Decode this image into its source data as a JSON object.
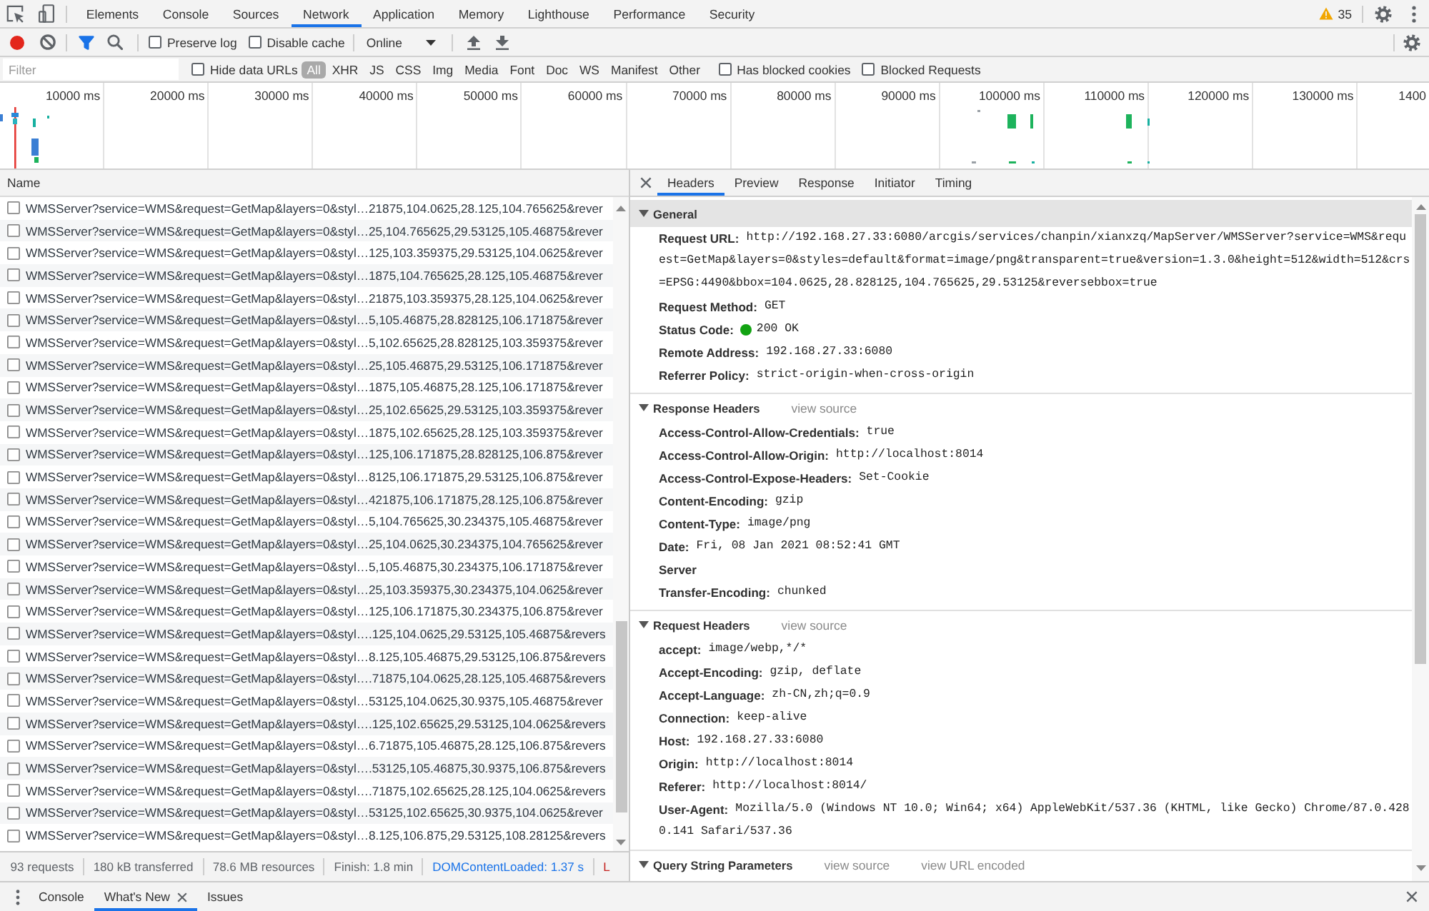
{
  "devtools_tabs": [
    {
      "label": "Elements",
      "selected": false
    },
    {
      "label": "Console",
      "selected": false
    },
    {
      "label": "Sources",
      "selected": false
    },
    {
      "label": "Network",
      "selected": true
    },
    {
      "label": "Application",
      "selected": false
    },
    {
      "label": "Memory",
      "selected": false
    },
    {
      "label": "Lighthouse",
      "selected": false
    },
    {
      "label": "Performance",
      "selected": false
    },
    {
      "label": "Security",
      "selected": false
    }
  ],
  "warnings": {
    "count": "35"
  },
  "toolbar": {
    "recording": true,
    "filter_active": true,
    "checkboxes": [
      {
        "label": "Preserve log",
        "checked": false
      },
      {
        "label": "Disable cache",
        "checked": false
      }
    ],
    "throttling": "Online"
  },
  "filter_bar": {
    "placeholder": "Filter",
    "hide_data_urls": {
      "label": "Hide data URLs",
      "checked": false
    },
    "types": [
      {
        "label": "All",
        "selected": true
      },
      {
        "label": "XHR",
        "selected": false
      },
      {
        "label": "JS",
        "selected": false
      },
      {
        "label": "CSS",
        "selected": false
      },
      {
        "label": "Img",
        "selected": false
      },
      {
        "label": "Media",
        "selected": false
      },
      {
        "label": "Font",
        "selected": false
      },
      {
        "label": "Doc",
        "selected": false
      },
      {
        "label": "WS",
        "selected": false
      },
      {
        "label": "Manifest",
        "selected": false
      },
      {
        "label": "Other",
        "selected": false
      }
    ],
    "checkboxes": [
      {
        "label": "Has blocked cookies",
        "checked": false
      },
      {
        "label": "Blocked Requests",
        "checked": false
      }
    ]
  },
  "overview": {
    "ticks": [
      "10000 ms",
      "20000 ms",
      "30000 ms",
      "40000 ms",
      "50000 ms",
      "60000 ms",
      "70000 ms",
      "80000 ms",
      "90000 ms",
      "100000 ms",
      "110000 ms",
      "120000 ms",
      "130000 ms",
      "1400"
    ]
  },
  "requests": {
    "column": "Name",
    "rows": [
      {
        "name": "WMSServer?service=WMS&request=GetMap&layers=0&styl…21875,104.0625,28.125,104.765625&rever",
        "selected": false
      },
      {
        "name": "WMSServer?service=WMS&request=GetMap&layers=0&styl…25,104.765625,29.53125,105.46875&rever",
        "selected": false
      },
      {
        "name": "WMSServer?service=WMS&request=GetMap&layers=0&styl…125,103.359375,29.53125,104.0625&rever",
        "selected": false
      },
      {
        "name": "WMSServer?service=WMS&request=GetMap&layers=0&styl…1875,104.765625,28.125,105.46875&rever",
        "selected": false
      },
      {
        "name": "WMSServer?service=WMS&request=GetMap&layers=0&styl…21875,103.359375,28.125,104.0625&rever",
        "selected": false
      },
      {
        "name": "WMSServer?service=WMS&request=GetMap&layers=0&styl…5,105.46875,28.828125,106.171875&rever",
        "selected": false
      },
      {
        "name": "WMSServer?service=WMS&request=GetMap&layers=0&styl…5,102.65625,28.828125,103.359375&rever",
        "selected": false
      },
      {
        "name": "WMSServer?service=WMS&request=GetMap&layers=0&styl…25,105.46875,29.53125,106.171875&rever",
        "selected": false
      },
      {
        "name": "WMSServer?service=WMS&request=GetMap&layers=0&styl…1875,105.46875,28.125,106.171875&rever",
        "selected": false
      },
      {
        "name": "WMSServer?service=WMS&request=GetMap&layers=0&styl…25,102.65625,29.53125,103.359375&rever",
        "selected": false
      },
      {
        "name": "WMSServer?service=WMS&request=GetMap&layers=0&styl…1875,102.65625,28.125,103.359375&rever",
        "selected": false
      },
      {
        "name": "WMSServer?service=WMS&request=GetMap&layers=0&styl…125,106.171875,28.828125,106.875&rever",
        "selected": false
      },
      {
        "name": "WMSServer?service=WMS&request=GetMap&layers=0&styl…8125,106.171875,29.53125,106.875&rever",
        "selected": false
      },
      {
        "name": "WMSServer?service=WMS&request=GetMap&layers=0&styl…421875,106.171875,28.125,106.875&rever",
        "selected": false
      },
      {
        "name": "WMSServer?service=WMS&request=GetMap&layers=0&styl…5,104.765625,30.234375,105.46875&rever",
        "selected": false
      },
      {
        "name": "WMSServer?service=WMS&request=GetMap&layers=0&styl…25,104.0625,30.234375,104.765625&rever",
        "selected": false
      },
      {
        "name": "WMSServer?service=WMS&request=GetMap&layers=0&styl…5,105.46875,30.234375,106.171875&rever",
        "selected": false
      },
      {
        "name": "WMSServer?service=WMS&request=GetMap&layers=0&styl…25,103.359375,30.234375,104.0625&rever",
        "selected": false
      },
      {
        "name": "WMSServer?service=WMS&request=GetMap&layers=0&styl…125,106.171875,30.234375,106.875&rever",
        "selected": false
      },
      {
        "name": "WMSServer?service=WMS&request=GetMap&layers=0&styl….125,104.0625,29.53125,105.46875&revers",
        "selected": false
      },
      {
        "name": "WMSServer?service=WMS&request=GetMap&layers=0&styl…8.125,105.46875,29.53125,106.875&revers",
        "selected": false
      },
      {
        "name": "WMSServer?service=WMS&request=GetMap&layers=0&styl….71875,104.0625,28.125,105.46875&revers",
        "selected": false
      },
      {
        "name": "WMSServer?service=WMS&request=GetMap&layers=0&styl…53125,104.0625,30.9375,105.46875&rever",
        "selected": false
      },
      {
        "name": "WMSServer?service=WMS&request=GetMap&layers=0&styl….125,102.65625,29.53125,104.0625&revers",
        "selected": false
      },
      {
        "name": "WMSServer?service=WMS&request=GetMap&layers=0&styl…6.71875,105.46875,28.125,106.875&revers",
        "selected": false
      },
      {
        "name": "WMSServer?service=WMS&request=GetMap&layers=0&styl….53125,105.46875,30.9375,106.875&revers",
        "selected": false
      },
      {
        "name": "WMSServer?service=WMS&request=GetMap&layers=0&styl….71875,102.65625,28.125,104.0625&revers",
        "selected": false
      },
      {
        "name": "WMSServer?service=WMS&request=GetMap&layers=0&styl…53125,102.65625,30.9375,104.0625&rever",
        "selected": false
      },
      {
        "name": "WMSServer?service=WMS&request=GetMap&layers=0&styl…8.125,106.875,29.53125,108.28125&revers",
        "selected": false
      }
    ]
  },
  "status_bar": [
    {
      "text": "93 requests",
      "kind": "summary"
    },
    {
      "text": "180 kB transferred",
      "kind": "summary"
    },
    {
      "text": "78.6 MB resources",
      "kind": "summary"
    },
    {
      "text": "Finish: 1.8 min",
      "kind": "summary"
    },
    {
      "text": "DOMContentLoaded: 1.37 s",
      "kind": "domcontentloaded"
    },
    {
      "text": "L",
      "kind": "load"
    }
  ],
  "details": {
    "tabs": [
      {
        "label": "Headers",
        "selected": true
      },
      {
        "label": "Preview",
        "selected": false
      },
      {
        "label": "Response",
        "selected": false
      },
      {
        "label": "Initiator",
        "selected": false
      },
      {
        "label": "Timing",
        "selected": false
      }
    ],
    "sections": [
      {
        "title": "General",
        "expanded": true,
        "focused": true,
        "rows": [
          {
            "name": "Request URL:",
            "value": "http://192.168.27.33:6080/arcgis/services/chanpin/xianxzq/MapServer/WMSServer?service=WMS&request=GetMap&layers=0&styles=default&format=image/png&transparent=true&version=1.3.0&height=512&width=512&crs=EPSG:4490&bbox=104.0625,28.828125,104.765625,29.53125&reversebbox=true"
          },
          {
            "name": "Request Method:",
            "value": "GET"
          },
          {
            "name": "Status Code:",
            "value": "200 OK",
            "color": "#12a312"
          },
          {
            "name": "Remote Address:",
            "value": "192.168.27.33:6080"
          },
          {
            "name": "Referrer Policy:",
            "value": "strict-origin-when-cross-origin"
          }
        ]
      },
      {
        "title": "Response Headers",
        "expanded": true,
        "focused": false,
        "links": [
          "view source"
        ],
        "rows": [
          {
            "name": "Access-Control-Allow-Credentials:",
            "value": "true"
          },
          {
            "name": "Access-Control-Allow-Origin:",
            "value": "http://localhost:8014"
          },
          {
            "name": "Access-Control-Expose-Headers:",
            "value": "Set-Cookie"
          },
          {
            "name": "Content-Encoding:",
            "value": "gzip"
          },
          {
            "name": "Content-Type:",
            "value": "image/png"
          },
          {
            "name": "Date:",
            "value": "Fri, 08 Jan 2021 08:52:41 GMT"
          },
          {
            "name": "Server"
          },
          {
            "name": "Transfer-Encoding:",
            "value": "chunked"
          }
        ]
      },
      {
        "title": "Request Headers",
        "expanded": true,
        "focused": false,
        "links": [
          "view source"
        ],
        "rows": [
          {
            "name": "accept:",
            "value": "image/webp,*/*"
          },
          {
            "name": "Accept-Encoding:",
            "value": "gzip, deflate"
          },
          {
            "name": "Accept-Language:",
            "value": "zh-CN,zh;q=0.9"
          },
          {
            "name": "Connection:",
            "value": "keep-alive"
          },
          {
            "name": "Host:",
            "value": "192.168.27.33:6080"
          },
          {
            "name": "Origin:",
            "value": "http://localhost:8014"
          },
          {
            "name": "Referer:",
            "value": "http://localhost:8014/"
          },
          {
            "name": "User-Agent:",
            "value": "Mozilla/5.0 (Windows NT 10.0; Win64; x64) AppleWebKit/537.36 (KHTML, like Gecko) Chrome/87.0.4280.141 Safari/537.36"
          }
        ]
      },
      {
        "title": "Query String Parameters",
        "expanded": true,
        "focused": false,
        "links": [
          "view source",
          "view URL encoded"
        ]
      }
    ]
  },
  "drawer": {
    "tabs": [
      {
        "label": "Console",
        "selected": false,
        "closable": false
      },
      {
        "label": "What's New",
        "selected": true,
        "closable": true
      },
      {
        "label": "Issues",
        "selected": false,
        "closable": false
      }
    ]
  }
}
